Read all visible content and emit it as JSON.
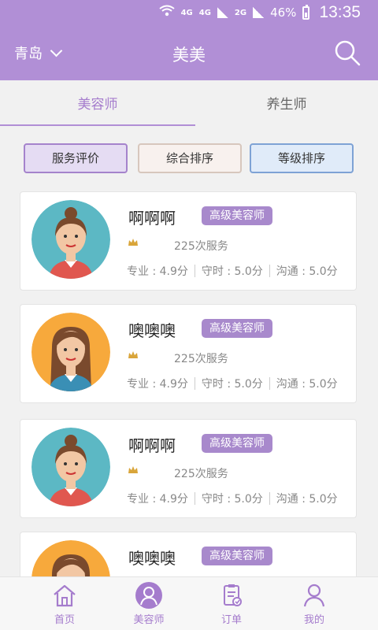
{
  "status_bar": {
    "network": "4G",
    "network2": "4G",
    "network3": "2G",
    "battery": "46%",
    "time": "13:35"
  },
  "header": {
    "city": "青岛",
    "title": "美美"
  },
  "tabs": [
    {
      "label": "美容师",
      "active": true
    },
    {
      "label": "养生师",
      "active": false
    }
  ],
  "sort_buttons": [
    {
      "label": "服务评价"
    },
    {
      "label": "综合排序"
    },
    {
      "label": "等级排序"
    }
  ],
  "beauticians": [
    {
      "name": "啊啊啊",
      "level": "高级美容师",
      "services": "225次服务",
      "professional": "专业 : 4.9分",
      "punctual": "守时 : 5.0分",
      "communication": "沟通 : 5.0分",
      "avatar": "avatar-bun-teal"
    },
    {
      "name": "噢噢噢",
      "level": "高级美容师",
      "services": "225次服务",
      "professional": "专业 : 4.9分",
      "punctual": "守时 : 5.0分",
      "communication": "沟通 : 5.0分",
      "avatar": "avatar-longhair-orange"
    },
    {
      "name": "啊啊啊",
      "level": "高级美容师",
      "services": "225次服务",
      "professional": "专业 : 4.9分",
      "punctual": "守时 : 5.0分",
      "communication": "沟通 : 5.0分",
      "avatar": "avatar-bun-teal"
    },
    {
      "name": "噢噢噢",
      "level": "高级美容师",
      "avatar": "avatar-longhair-orange"
    }
  ],
  "bottom_nav": [
    {
      "label": "首页",
      "icon": "home-icon"
    },
    {
      "label": "美容师",
      "icon": "beautician-icon",
      "active": true
    },
    {
      "label": "订单",
      "icon": "order-icon"
    },
    {
      "label": "我的",
      "icon": "profile-icon"
    }
  ],
  "colors": {
    "primary": "#b18fd6",
    "accent_text": "#a57ccd",
    "badge": "#a889cc",
    "teal_bg": "#5cb8c4",
    "orange_bg": "#f7a93c"
  }
}
